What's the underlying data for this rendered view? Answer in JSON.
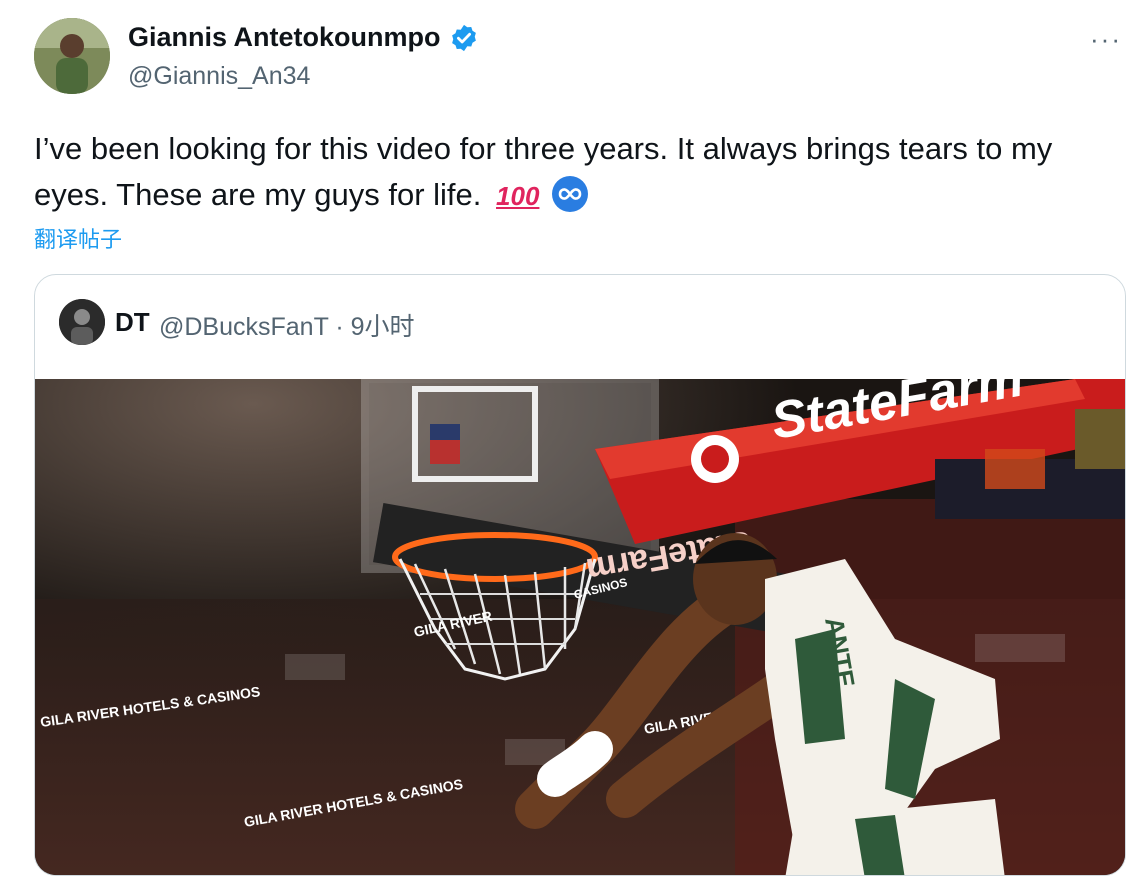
{
  "tweet": {
    "author_name": "Giannis Antetokounmpo",
    "author_handle": "@Giannis_An34",
    "text": "I’ve been looking for this video for three years. It always brings tears to my eyes. These are my guys for life.",
    "emoji_100": "100",
    "more_label": "···",
    "translate_label": "翻译帖子"
  },
  "quote": {
    "author_name": "DT",
    "meta": "@DBucksFanT · 9小时",
    "media": {
      "banner_text": "StateFarm",
      "banner_text_mirrored": "StateFarm",
      "ad_lines": [
        "GILA RIVER HOTELS & CASINOS",
        "GILA RIVER",
        "GILA RIVER HOTELS & CASINOS",
        "GILA RIVER",
        "CASINOS"
      ],
      "jersey_text": "ANTE"
    }
  },
  "colors": {
    "accent": "#1d9bf0",
    "text_primary": "#0f1419",
    "text_secondary": "#536471",
    "border": "#cfd9de"
  }
}
